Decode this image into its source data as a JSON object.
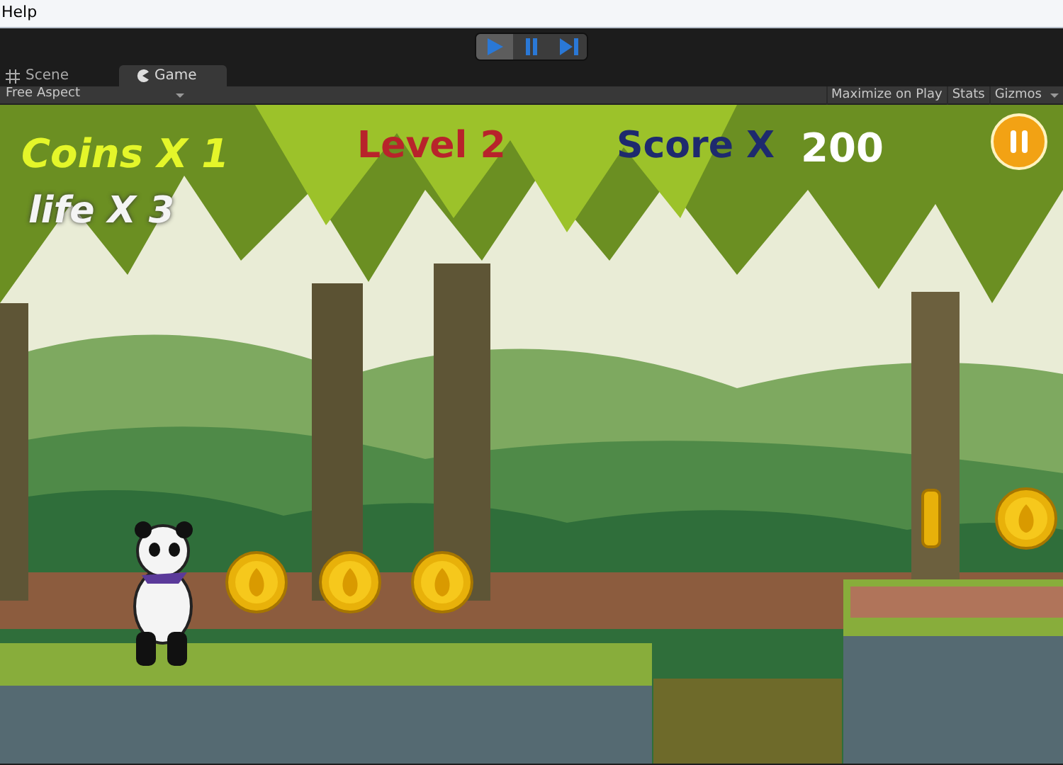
{
  "menu_bar": {
    "items": [
      "Help"
    ]
  },
  "playback": [
    {
      "kind": "play",
      "selected": true
    },
    {
      "kind": "pause",
      "selected": false
    },
    {
      "kind": "step",
      "selected": false
    }
  ],
  "tabs": [
    {
      "label": "Scene",
      "kind": "grid",
      "selected": false
    },
    {
      "label": "Game",
      "kind": "pac",
      "selected": true
    }
  ],
  "game_toolbar": {
    "aspect": "Free Aspect",
    "buttons": [
      "Maximize on Play",
      "Stats",
      "Gizmos"
    ]
  },
  "hud": {
    "coins": "Coins X 1",
    "life": "life X 3",
    "level": "Level 2",
    "score_label": "Score X",
    "score": "200"
  }
}
